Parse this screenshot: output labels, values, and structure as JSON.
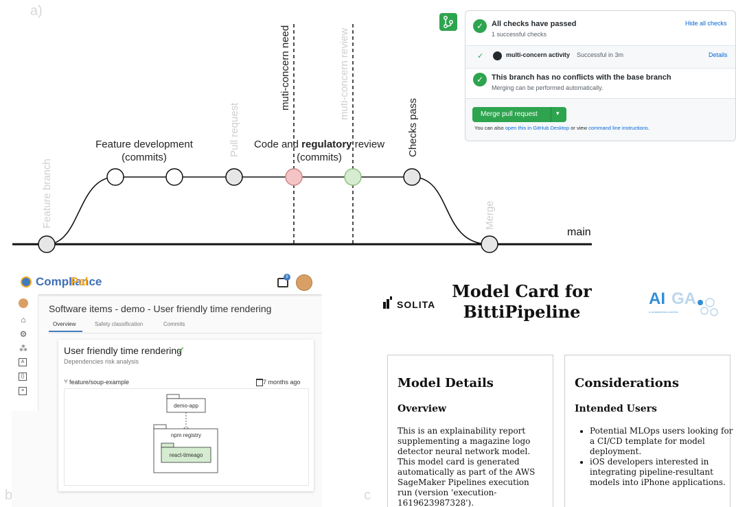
{
  "panel_labels": {
    "a": "a)",
    "b": "b)",
    "c": "c)"
  },
  "diagram": {
    "labels": {
      "feature_branch": "Feature branch",
      "feature_dev_line1": "Feature  development",
      "feature_dev_line2": "(commits)",
      "pull_request": "Pull request",
      "code_review_pre": "Code and ",
      "code_review_bold": "regulatory",
      "code_review_post": " review",
      "code_review_line2": "(commits)",
      "multi_concern_need": "muti-concern need",
      "multi_concern_review": "muti-concern review",
      "checks_pass": "Checks pass",
      "merge": "Merge",
      "main": "main"
    },
    "colors": {
      "commit_open": "#ffffff",
      "commit_grey": "#e6e6e6",
      "commit_red": "#f5c4c4",
      "commit_green": "#d5ecd0"
    }
  },
  "github": {
    "checks_title": "All checks have passed",
    "checks_sub": "1 successful checks",
    "hide_link": "Hide all checks",
    "check_name": "multi-concern activity",
    "check_status": "Successful in 3m",
    "details_link": "Details",
    "conflicts_title": "This branch has no conflicts with the base branch",
    "conflicts_sub": "Merging can be performed automatically.",
    "merge_button": "Merge pull request",
    "footer_pre": "You can also ",
    "footer_link1": "open this in GitHub Desktop",
    "footer_mid": " or view ",
    "footer_link2": "command line instructions",
    "footer_post": ".",
    "accent": "#2ea44f"
  },
  "compliancepal": {
    "brand_part1": "Compliance",
    "brand_part2": "Pal",
    "notification_count": "8",
    "page_title": "Software items - demo - User friendly time rendering",
    "tabs": [
      "Overview",
      "Safety classification",
      "Commits"
    ],
    "active_tab": "Overview",
    "card_title": "User friendly time rendering",
    "card_check": "✓",
    "card_subtitle": "Dependencies risk analysis",
    "branch": "feature/soup-example",
    "date": "7 months ago",
    "dependency_nodes": {
      "app": "demo-app",
      "registry": "npm registry",
      "package": "react-timeago"
    }
  },
  "model_card": {
    "title": "Model Card for BittiPipeline",
    "logo_left": "SOLITA",
    "logo_right_a": "AI",
    "logo_right_b": "GA",
    "logo_right_sub": "AI GOVERNANCE & AUDITING",
    "details": {
      "heading": "Model Details",
      "subheading": "Overview",
      "text": "This is an explainability report supplementing a magazine logo detector neural network model. This model card is generated automatically as part of the AWS SageMaker Pipelines execution run (version 'execution-1619623987328')."
    },
    "considerations": {
      "heading": "Considerations",
      "subheading": "Intended Users",
      "items": [
        "Potential MLOps users looking for a CI/CD template for model deployment.",
        "iOS developers interested in integrating pipeline-resultant models into iPhone applications."
      ]
    }
  }
}
